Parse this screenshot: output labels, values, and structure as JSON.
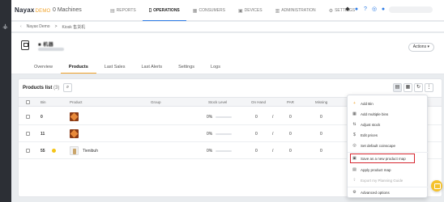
{
  "topbar": {
    "logo": "Nayax",
    "logo_suffix": "DEMO",
    "context": "0 Machines",
    "nav": [
      {
        "label": "REPORTS",
        "icon": "report-icon"
      },
      {
        "label": "OPERATIONS",
        "icon": "operations-icon",
        "active": true
      },
      {
        "label": "CONSUMERS",
        "icon": "consumers-icon"
      },
      {
        "label": "DEVICES",
        "icon": "devices-icon"
      },
      {
        "label": "ADMINISTRATION",
        "icon": "administration-icon"
      },
      {
        "label": "SETTINGS",
        "icon": "settings-icon"
      }
    ]
  },
  "breadcrumb": {
    "items": [
      "Nayax Demo",
      "Kiosk 售货机"
    ],
    "sep": ">"
  },
  "machine": {
    "name": "■ 机器",
    "actions_label": "Actions"
  },
  "tabs": [
    {
      "label": "Overview"
    },
    {
      "label": "Products",
      "active": true
    },
    {
      "label": "Last Sales"
    },
    {
      "label": "Last Alerts"
    },
    {
      "label": "Settings"
    },
    {
      "label": "Logs"
    }
  ],
  "products": {
    "title": "Products list",
    "count": "(3)",
    "columns": [
      "Bin",
      "Product",
      "Group",
      "Stock Level",
      "On Hand",
      "PAR",
      "Missing"
    ],
    "rows": [
      {
        "bin": "0",
        "name": "",
        "stock": "0%",
        "on_hand": "0",
        "slash": "/",
        "par": "0",
        "missing": "0",
        "stock_fraction": 0
      },
      {
        "bin": "11",
        "name": "",
        "stock": "0%",
        "on_hand": "0",
        "slash": "/",
        "par": "0",
        "missing": "0",
        "stock_fraction": 0
      },
      {
        "bin": "55",
        "name": "Tienibuh",
        "stock": "0%",
        "on_hand": "0",
        "slash": "/",
        "par": "0",
        "missing": "0",
        "stock_fraction": 0
      }
    ]
  },
  "menu": {
    "items": [
      {
        "label": "Add Bin",
        "icon": "plus-icon",
        "name": "menu-add-bin"
      },
      {
        "label": "Add multiple bins",
        "icon": "grid-icon",
        "name": "menu-add-multiple-bins"
      },
      {
        "label": "Adjust stock",
        "icon": "adjust-icon",
        "name": "menu-adjust-stock"
      },
      {
        "label": "Edit prices",
        "icon": "price-icon",
        "name": "menu-edit-prices"
      },
      {
        "label": "Set default coinscape",
        "icon": "coin-icon",
        "name": "menu-set-default-coinscape"
      },
      {
        "label": "Save as a new product map",
        "icon": "save-icon",
        "name": "menu-save-product-map",
        "highlight": true
      },
      {
        "label": "Apply product map",
        "icon": "map-icon",
        "name": "menu-apply-product-map"
      },
      {
        "label": "Export my Planning Guide",
        "icon": "export-icon",
        "name": "menu-export-planning-guide",
        "disabled": true
      },
      {
        "label": "Advanced options",
        "icon": "options-icon",
        "name": "menu-advanced-options"
      }
    ]
  }
}
